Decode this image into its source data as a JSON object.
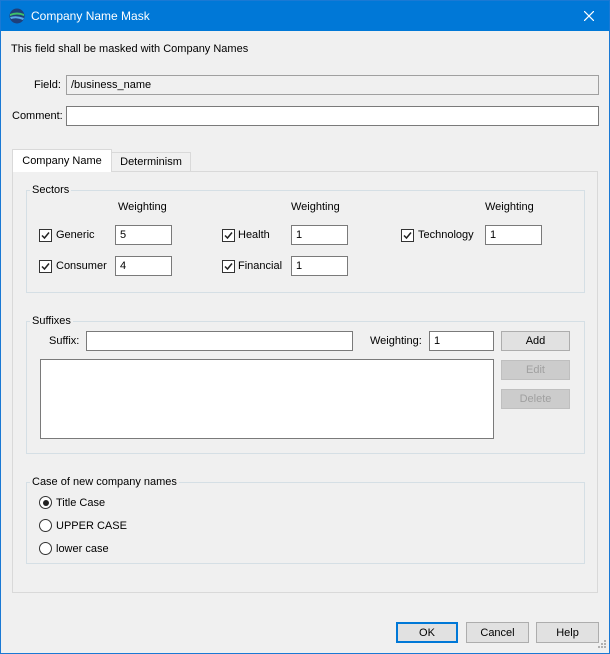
{
  "window": {
    "title": "Company Name Mask",
    "description": "This field shall be masked with Company Names",
    "close_icon": "close-icon",
    "app_icon": "globe-icon"
  },
  "field": {
    "label": "Field:",
    "value": "/business_name"
  },
  "comment": {
    "label": "Comment:",
    "value": ""
  },
  "tabs": [
    {
      "label": "Company Name",
      "active": true
    },
    {
      "label": "Determinism",
      "active": false
    }
  ],
  "sectors": {
    "title": "Sectors",
    "weighting_header": "Weighting",
    "items": [
      {
        "label": "Generic",
        "checked": true,
        "weight": "5"
      },
      {
        "label": "Consumer",
        "checked": true,
        "weight": "4"
      },
      {
        "label": "Health",
        "checked": true,
        "weight": "1"
      },
      {
        "label": "Financial",
        "checked": true,
        "weight": "1"
      },
      {
        "label": "Technology",
        "checked": true,
        "weight": "1"
      }
    ]
  },
  "suffixes": {
    "title": "Suffixes",
    "suffix_label": "Suffix:",
    "suffix_value": "",
    "weighting_label": "Weighting:",
    "weighting_value": "1",
    "add_label": "Add",
    "edit_label": "Edit",
    "delete_label": "Delete",
    "items": []
  },
  "case": {
    "title": "Case of new company names",
    "options": [
      {
        "label": "Title Case",
        "selected": true
      },
      {
        "label": "UPPER CASE",
        "selected": false
      },
      {
        "label": "lower case",
        "selected": false
      }
    ]
  },
  "buttons": {
    "ok": "OK",
    "cancel": "Cancel",
    "help": "Help"
  },
  "colors": {
    "titlebar": "#0078d7",
    "accent": "#0078d7"
  }
}
